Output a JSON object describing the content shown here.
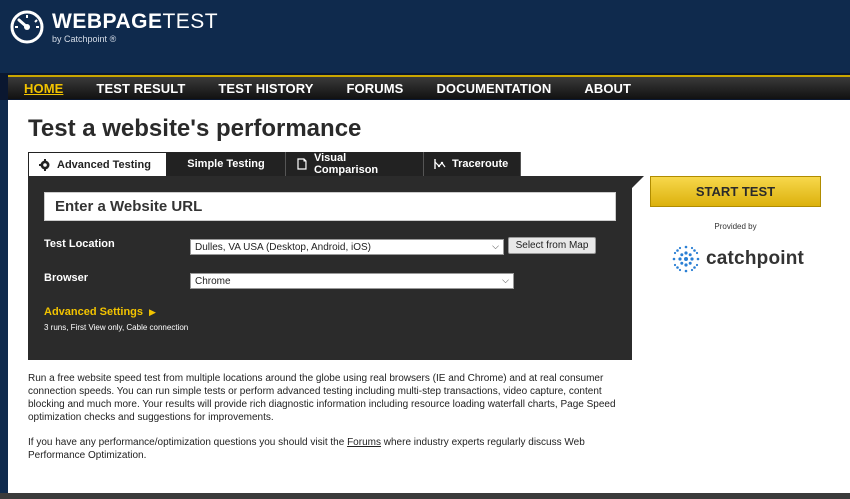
{
  "brand": {
    "title_bold": "WEBPAGE",
    "title_light": "TEST",
    "subtitle": "by Catchpoint",
    "subtitle_mark": "®"
  },
  "nav": {
    "items": [
      {
        "label": "HOME",
        "active": true
      },
      {
        "label": "TEST RESULT",
        "active": false
      },
      {
        "label": "TEST HISTORY",
        "active": false
      },
      {
        "label": "FORUMS",
        "active": false
      },
      {
        "label": "DOCUMENTATION",
        "active": false
      },
      {
        "label": "ABOUT",
        "active": false
      }
    ]
  },
  "page": {
    "title": "Test a website's performance"
  },
  "tabs": [
    {
      "label": "Advanced Testing",
      "icon": "gear-icon",
      "active": true
    },
    {
      "label": "Simple Testing",
      "icon": "",
      "active": false
    },
    {
      "label": "Visual Comparison",
      "icon": "document-icon",
      "active": false
    },
    {
      "label": "Traceroute",
      "icon": "traceroute-icon",
      "active": false
    }
  ],
  "form": {
    "url_placeholder": "Enter a Website URL",
    "location_label": "Test Location",
    "location_value": "Dulles, VA USA (Desktop, Android, iOS)",
    "map_button": "Select from Map",
    "browser_label": "Browser",
    "browser_value": "Chrome",
    "advanced_label": "Advanced Settings",
    "advanced_arrow": "▶",
    "advanced_summary": "3 runs, First View only, Cable connection"
  },
  "sidebar": {
    "start_button": "START TEST",
    "provided_by": "Provided by",
    "partner": "catchpoint"
  },
  "content": {
    "description": "Run a free website speed test from multiple locations around the globe using real browsers (IE and Chrome) and at real consumer connection speeds. You can run simple tests or perform advanced testing including multi-step transactions, video capture, content blocking and much more. Your results will provide rich diagnostic information including resource loading waterfall charts, Page Speed optimization checks and suggestions for improvements.",
    "help_before": "If you have any performance/optimization questions you should visit the ",
    "help_link": "Forums",
    "help_after": " where industry experts regularly discuss Web Performance Optimization."
  },
  "colors": {
    "header_bg": "#0f2a4d",
    "accent_yellow": "#f2c300",
    "panel_bg": "#2b2b2b",
    "catchpoint_blue": "#2a7fd4"
  }
}
